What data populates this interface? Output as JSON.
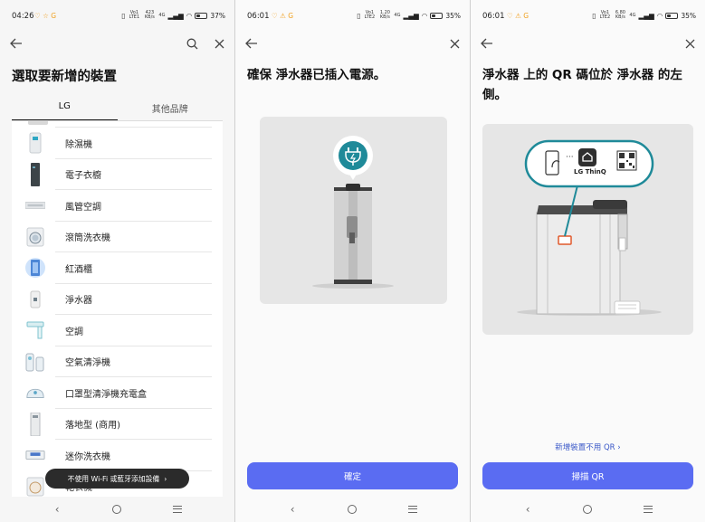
{
  "screen1": {
    "status": {
      "time": "04:26",
      "notif": "♡ ☆ G",
      "net_a": "Vo1 LTE1",
      "net_b": "423 KB/s",
      "net_c": "4G",
      "battery": "37%"
    },
    "title": "選取要新增的裝置",
    "tabs": [
      {
        "label": "LG"
      },
      {
        "label": "其他品牌"
      }
    ],
    "devices": [
      {
        "label": "除濕機"
      },
      {
        "label": "電子衣櫥"
      },
      {
        "label": "風管空調"
      },
      {
        "label": "滾筒洗衣機"
      },
      {
        "label": "紅酒櫃"
      },
      {
        "label": "淨水器"
      },
      {
        "label": "空調"
      },
      {
        "label": "空氣清淨機"
      },
      {
        "label": "口罩型清淨機充電盒"
      },
      {
        "label": "落地型 (商用)"
      },
      {
        "label": "迷你洗衣機"
      },
      {
        "label": "乾衣機"
      }
    ],
    "pill_label": "不使用 Wi-Fi 或藍牙添加設備",
    "pill_chevron": "›"
  },
  "screen2": {
    "status": {
      "time": "06:01",
      "notif": "♡ ⚠ G",
      "net_a": "Vo1 LTE2",
      "net_b": "1.20 KB/s",
      "net_c": "4G",
      "battery": "35%"
    },
    "heading": "確保 淨水器已插入電源。",
    "confirm_label": "確定"
  },
  "screen3": {
    "status": {
      "time": "06:01",
      "notif": "♡ ⚠ G",
      "net_a": "Vo1 LTE2",
      "net_b": "6.80 KB/s",
      "net_c": "4G",
      "battery": "35%"
    },
    "heading": "淨水器 上的 QR 碼位於 淨水器 的左側。",
    "bubble_brand": "LG ThinQ",
    "bubble_dots": "···",
    "link_label": "新增裝置不用 QR",
    "link_chevron": "›",
    "scan_label": "掃描 QR"
  },
  "colors": {
    "accent": "#5a6cf2",
    "teal": "#1f8a99",
    "link": "#3a58c8"
  },
  "icons": [
    "back-arrow-icon",
    "search-icon",
    "close-icon",
    "plug-icon",
    "qr-code-icon",
    "lg-thinq-home-icon",
    "phone-scan-icon"
  ]
}
